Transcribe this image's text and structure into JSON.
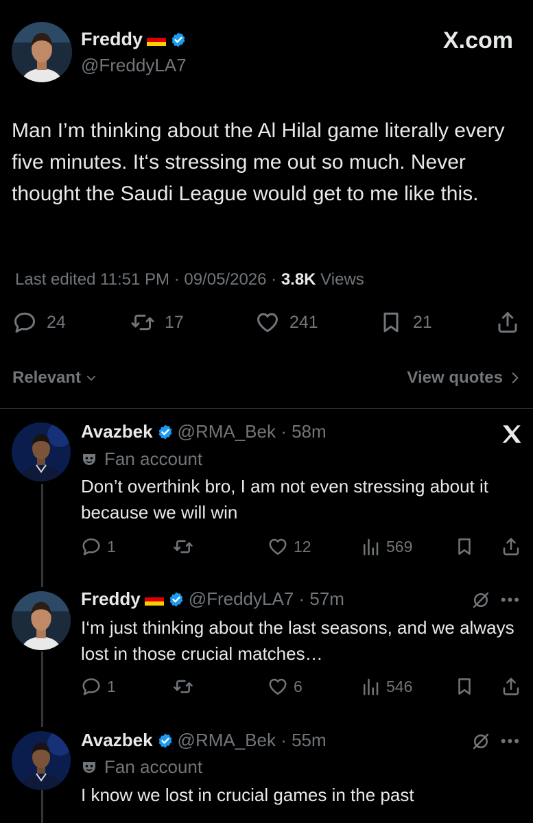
{
  "site_label": "X.com",
  "main_tweet": {
    "author_name": "Freddy",
    "handle": "@FreddyLA7",
    "text": "Man I’m thinking about the Al Hilal game literally every five minutes. It‘s stressing me out so much. Never thought the Saudi League would get to me like this.",
    "edited_label": "Last edited 11:51 PM · 09/05/2026 · ",
    "views_count": "3.8K",
    "views_label": " Views",
    "replies": "24",
    "reposts": "17",
    "likes": "241",
    "bookmarks": "21"
  },
  "sort": {
    "relevant_label": "Relevant",
    "view_quotes_label": "View quotes"
  },
  "replies": [
    {
      "author_name": "Avazbek",
      "handle_time": "@RMA_Bek · 58m",
      "fan_label": "Fan account",
      "text": "Don’t overthink bro, I am not even stressing about it because we will win",
      "replies": "1",
      "likes": "12",
      "views": "569"
    },
    {
      "author_name": "Freddy",
      "handle_time": "@FreddyLA7 · 57m",
      "text": "I‘m just thinking about the last seasons, and we always lost in those crucial matches…",
      "replies": "1",
      "likes": "6",
      "views": "546"
    },
    {
      "author_name": "Avazbek",
      "handle_time": "@RMA_Bek · 55m",
      "fan_label": "Fan account",
      "text": "I know we lost in crucial games in the past"
    }
  ],
  "colors": {
    "background": "#000000",
    "text_primary": "#e7e9ea",
    "text_secondary": "#71767b",
    "verified_blue": "#1d9bf0",
    "divider": "#2f3336"
  },
  "icons": [
    "verified-badge-icon",
    "germany-flag-icon",
    "reply-icon",
    "repost-icon",
    "like-icon",
    "bookmark-icon",
    "share-icon",
    "views-icon",
    "chevron-down-icon",
    "chevron-right-icon",
    "x-logo-icon",
    "fan-mask-icon",
    "grok-icon",
    "more-icon"
  ]
}
